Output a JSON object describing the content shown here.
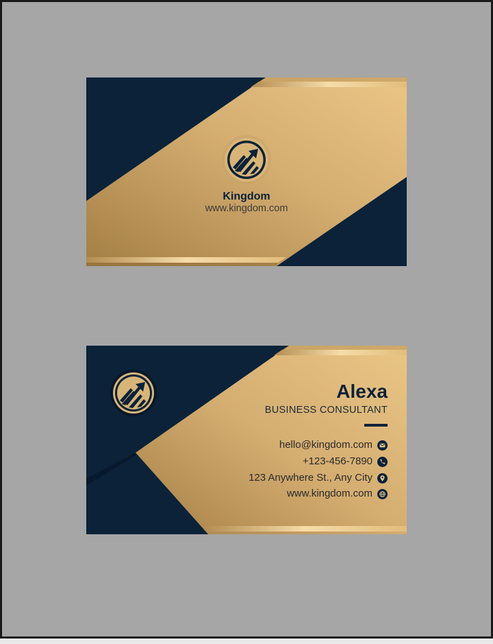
{
  "colors": {
    "navy": "#0b2239",
    "gold_dark": "#a47f45",
    "gold_light": "#eac686",
    "gray_background": "#a6a6a6"
  },
  "front": {
    "logo_icon": "rising-arrow-chart-icon",
    "brand_name": "Kingdom",
    "website": "www.kingdom.com"
  },
  "back": {
    "logo_icon": "rising-arrow-chart-icon",
    "name": "Alexa",
    "job_title": "BUSINESS CONSULTANT",
    "contacts": [
      {
        "text": "hello@kingdom.com",
        "icon": "email-icon"
      },
      {
        "text": "+123-456-7890",
        "icon": "phone-icon"
      },
      {
        "text": "123 Anywhere St., Any City",
        "icon": "location-pin-icon"
      },
      {
        "text": "www.kingdom.com",
        "icon": "globe-icon"
      }
    ]
  }
}
